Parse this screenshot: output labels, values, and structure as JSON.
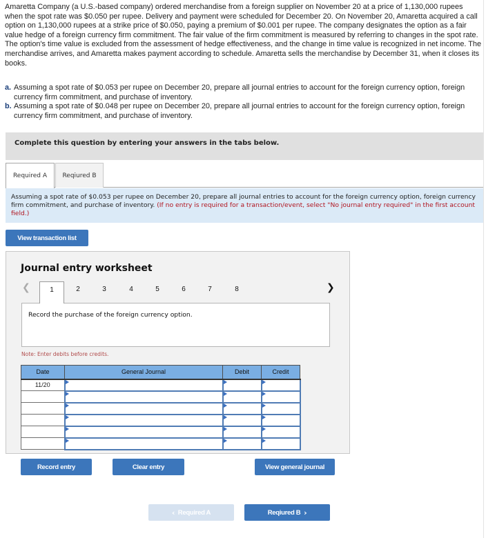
{
  "problem": {
    "intro": "Amaretta Company (a U.S.-based company) ordered merchandise from a foreign supplier on November 20 at a price of 1,130,000 rupees when the spot rate was $0.050 per rupee. Delivery and payment were scheduled for December 20. On November 20, Amaretta acquired a call option on 1,130,000 rupees at a strike price of $0.050, paying a premium of $0.001 per rupee. The company designates the option as a fair value hedge of a foreign currency firm commitment. The fair value of the firm commitment is measured by referring to changes in the spot rate. The option's time value is excluded from the assessment of hedge effectiveness, and the change in time value is recognized in net income. The merchandise arrives, and Amaretta makes payment according to schedule. Amaretta sells the merchandise by December 31, when it closes its books.",
    "parts": [
      {
        "letter": "a.",
        "text": "Assuming a spot rate of $0.053 per rupee on December 20, prepare all journal entries to account for the foreign currency option, foreign currency firm commitment, and purchase of inventory."
      },
      {
        "letter": "b.",
        "text": "Assuming a spot rate of $0.048 per rupee on December 20, prepare all journal entries to account for the foreign currency option, foreign currency firm commitment, and purchase of inventory."
      }
    ]
  },
  "instruction_bar": "Complete this question by entering your answers in the tabs below.",
  "tabs": [
    {
      "label": "Required A",
      "active": true
    },
    {
      "label": "Reqiured B",
      "active": false
    }
  ],
  "question": {
    "text": "Assuming a spot rate of $0.053 per rupee on December 20, prepare all journal entries to account for the foreign currency option, foreign currency firm commitment, and purchase of inventory.",
    "hint": "(If no entry is required for a transaction/event, select \"No journal entry required\" in the first account field.)"
  },
  "buttons": {
    "view_transaction_list": "View transaction list",
    "record_entry": "Record entry",
    "clear_entry": "Clear entry",
    "view_general_journal": "View general journal",
    "prev_required": "Required A",
    "next_required": "Reqiured B"
  },
  "worksheet": {
    "title": "Journal entry worksheet",
    "steps": [
      "1",
      "2",
      "3",
      "4",
      "5",
      "6",
      "7",
      "8"
    ],
    "active_step": "1",
    "prev_icon": "chevron-left-icon",
    "next_icon": "chevron-right-icon",
    "description": "Record the purchase of the foreign currency option.",
    "note": "Note: Enter debits before credits.",
    "table": {
      "headers": {
        "date": "Date",
        "account": "General Journal",
        "debit": "Debit",
        "credit": "Credit"
      },
      "rows": [
        {
          "date": "11/20",
          "account": "",
          "debit": "",
          "credit": ""
        },
        {
          "date": "",
          "account": "",
          "debit": "",
          "credit": ""
        },
        {
          "date": "",
          "account": "",
          "debit": "",
          "credit": ""
        },
        {
          "date": "",
          "account": "",
          "debit": "",
          "credit": ""
        },
        {
          "date": "",
          "account": "",
          "debit": "",
          "credit": ""
        },
        {
          "date": "",
          "account": "",
          "debit": "",
          "credit": ""
        }
      ]
    }
  },
  "colors": {
    "button_blue": "#3c76bb",
    "button_disabled": "#d6e2f0",
    "table_header": "#7aaee3",
    "question_bg": "#dbeaf7",
    "hint_red": "#b0141f",
    "instruction_bg": "#e0e0e0",
    "worksheet_bg": "#f2f2f2"
  }
}
